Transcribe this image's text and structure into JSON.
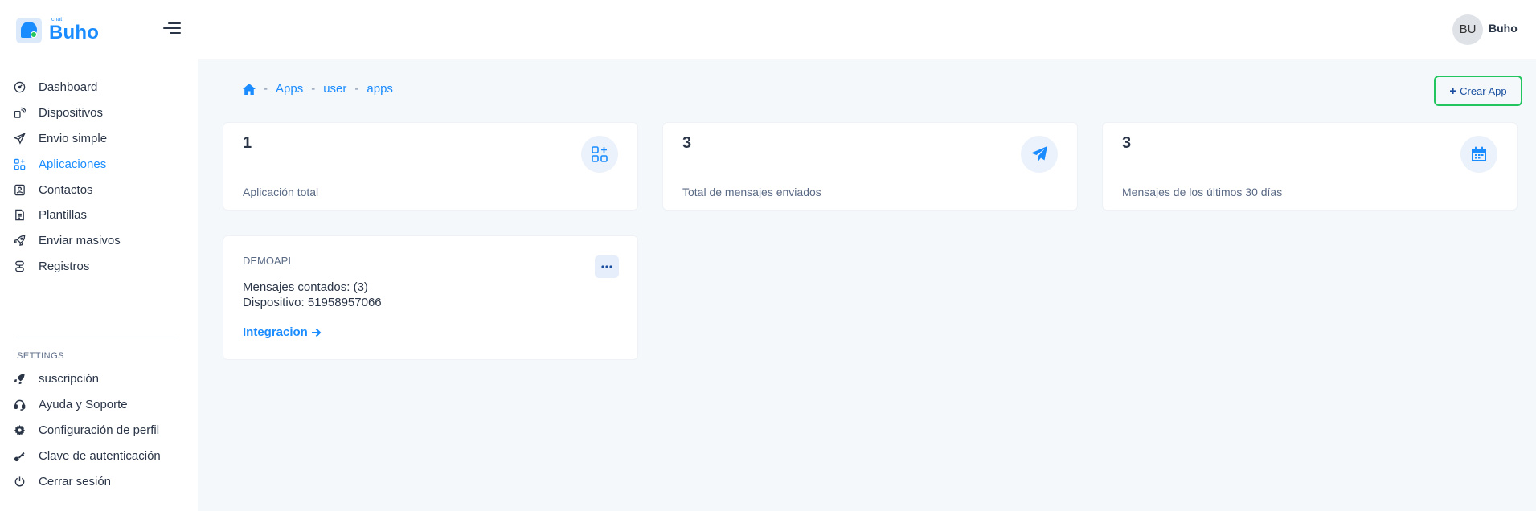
{
  "brand": {
    "small": "chat",
    "name": "Buho"
  },
  "user": {
    "initials": "BU",
    "name": "Buho"
  },
  "sidebar": {
    "items": [
      {
        "label": "Dashboard",
        "icon": "dashboard-icon"
      },
      {
        "label": "Dispositivos",
        "icon": "devices-icon"
      },
      {
        "label": "Envio simple",
        "icon": "send-icon"
      },
      {
        "label": "Aplicaciones",
        "icon": "apps-icon",
        "active": true
      },
      {
        "label": "Contactos",
        "icon": "contacts-icon"
      },
      {
        "label": "Plantillas",
        "icon": "templates-icon"
      },
      {
        "label": "Enviar masivos",
        "icon": "rocket-icon"
      },
      {
        "label": "Registros",
        "icon": "logs-icon"
      }
    ],
    "settings_title": "SETTINGS",
    "settings_items": [
      {
        "label": "suscripción",
        "icon": "subscription-icon"
      },
      {
        "label": "Ayuda y Soporte",
        "icon": "support-icon"
      },
      {
        "label": "Configuración de perfil",
        "icon": "gear-icon"
      },
      {
        "label": "Clave de autenticación",
        "icon": "key-icon"
      },
      {
        "label": "Cerrar sesión",
        "icon": "power-icon"
      }
    ]
  },
  "breadcrumb": {
    "items": [
      "Apps",
      "user",
      "apps"
    ],
    "separator": "-"
  },
  "create_button": {
    "label": "Crear App"
  },
  "stats": [
    {
      "value": "1",
      "label": "Aplicación total",
      "icon": "apps-add-icon"
    },
    {
      "value": "3",
      "label": "Total de mensajes enviados",
      "icon": "paper-plane-icon"
    },
    {
      "value": "3",
      "label": "Mensajes de los últimos 30 días",
      "icon": "calendar-icon"
    }
  ],
  "app_card": {
    "name": "DEMOAPI",
    "messages": "Mensajes contados: (3)",
    "device": "Dispositivo: 51958957066",
    "link": "Integracion"
  },
  "colors": {
    "accent": "#1a8cff",
    "success": "#22c55e",
    "text": "#2a3547",
    "muted": "#5a6a85"
  }
}
